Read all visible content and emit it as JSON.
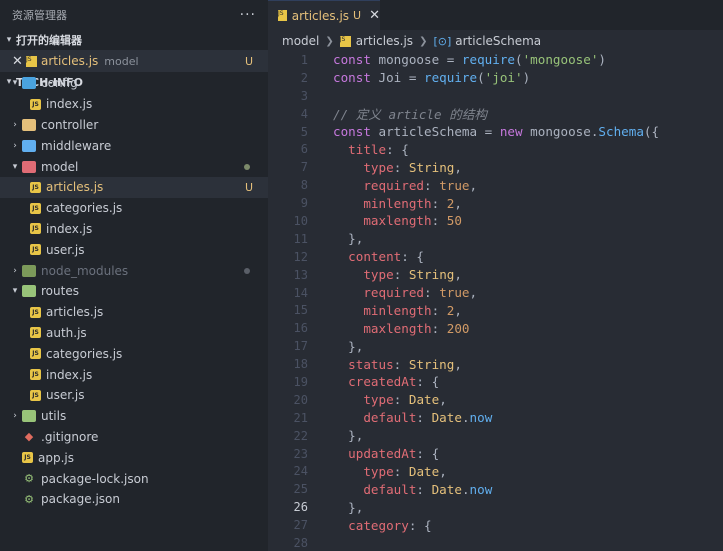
{
  "sidebar": {
    "title": "资源管理器",
    "more": "···",
    "open_editors_title": "打开的编辑器",
    "open_editor": {
      "close": "✕",
      "name": "articles.js",
      "dir": "model",
      "status": "U"
    },
    "project_title": "TECH-INFO",
    "tree": [
      {
        "label": "config",
        "kind": "folder",
        "expanded": true,
        "depth": 0,
        "folder_color": "#4aa3df"
      },
      {
        "label": "index.js",
        "kind": "js",
        "depth": 1
      },
      {
        "label": "controller",
        "kind": "folder",
        "expanded": false,
        "depth": 0,
        "folder_color": "#e5c07b"
      },
      {
        "label": "middleware",
        "kind": "folder",
        "expanded": false,
        "depth": 0,
        "folder_color": "#61afef"
      },
      {
        "label": "model",
        "kind": "folder",
        "expanded": true,
        "depth": 0,
        "folder_color": "#e06c75",
        "dot": true
      },
      {
        "label": "articles.js",
        "kind": "js",
        "depth": 1,
        "selected": true,
        "status": "U"
      },
      {
        "label": "categories.js",
        "kind": "js",
        "depth": 1
      },
      {
        "label": "index.js",
        "kind": "js",
        "depth": 1
      },
      {
        "label": "user.js",
        "kind": "js",
        "depth": 1
      },
      {
        "label": "node_modules",
        "kind": "folder",
        "expanded": false,
        "depth": 0,
        "folder_color": "#7c9a5a",
        "dim": true,
        "dot_grey": true
      },
      {
        "label": "routes",
        "kind": "folder",
        "expanded": true,
        "depth": 0,
        "folder_color": "#98c379"
      },
      {
        "label": "articles.js",
        "kind": "js",
        "depth": 1
      },
      {
        "label": "auth.js",
        "kind": "js",
        "depth": 1
      },
      {
        "label": "categories.js",
        "kind": "js",
        "depth": 1
      },
      {
        "label": "index.js",
        "kind": "js",
        "depth": 1
      },
      {
        "label": "user.js",
        "kind": "js",
        "depth": 1
      },
      {
        "label": "utils",
        "kind": "folder",
        "expanded": false,
        "depth": 0,
        "folder_color": "#98c379"
      },
      {
        "label": ".gitignore",
        "kind": "git",
        "depth": 0
      },
      {
        "label": "app.js",
        "kind": "js",
        "depth": 0
      },
      {
        "label": "package-lock.json",
        "kind": "json",
        "depth": 0
      },
      {
        "label": "package.json",
        "kind": "json",
        "depth": 0
      }
    ]
  },
  "editor": {
    "tab": {
      "name": "articles.js",
      "status": "U",
      "close": "✕"
    },
    "breadcrumb": {
      "folder": "model",
      "file": "articles.js",
      "symbol": "articleSchema"
    },
    "active_line": 26,
    "lines": [
      [
        [
          "kw",
          "const "
        ],
        [
          "plain",
          "mongoose = "
        ],
        [
          "fn",
          "require"
        ],
        [
          "pun",
          "("
        ],
        [
          "str",
          "'mongoose'"
        ],
        [
          "pun",
          ")"
        ]
      ],
      [
        [
          "kw",
          "const "
        ],
        [
          "plain",
          "Joi = "
        ],
        [
          "fn",
          "require"
        ],
        [
          "pun",
          "("
        ],
        [
          "str",
          "'joi'"
        ],
        [
          "pun",
          ")"
        ]
      ],
      [],
      [
        [
          "cm",
          "// 定义 article 的结构"
        ]
      ],
      [
        [
          "kw",
          "const "
        ],
        [
          "plain",
          "articleSchema = "
        ],
        [
          "kw",
          "new "
        ],
        [
          "plain",
          "mongoose."
        ],
        [
          "fn",
          "Schema"
        ],
        [
          "pun",
          "({"
        ]
      ],
      [
        [
          "plain",
          "  "
        ],
        [
          "prop",
          "title"
        ],
        [
          "pun",
          ": {"
        ]
      ],
      [
        [
          "plain",
          "    "
        ],
        [
          "prop",
          "type"
        ],
        [
          "pun",
          ": "
        ],
        [
          "type",
          "String"
        ],
        [
          "pun",
          ","
        ]
      ],
      [
        [
          "plain",
          "    "
        ],
        [
          "prop",
          "required"
        ],
        [
          "pun",
          ": "
        ],
        [
          "bool",
          "true"
        ],
        [
          "pun",
          ","
        ]
      ],
      [
        [
          "plain",
          "    "
        ],
        [
          "prop",
          "minlength"
        ],
        [
          "pun",
          ": "
        ],
        [
          "num",
          "2"
        ],
        [
          "pun",
          ","
        ]
      ],
      [
        [
          "plain",
          "    "
        ],
        [
          "prop",
          "maxlength"
        ],
        [
          "pun",
          ": "
        ],
        [
          "num",
          "50"
        ]
      ],
      [
        [
          "plain",
          "  "
        ],
        [
          "pun",
          "},"
        ]
      ],
      [
        [
          "plain",
          "  "
        ],
        [
          "prop",
          "content"
        ],
        [
          "pun",
          ": {"
        ]
      ],
      [
        [
          "plain",
          "    "
        ],
        [
          "prop",
          "type"
        ],
        [
          "pun",
          ": "
        ],
        [
          "type",
          "String"
        ],
        [
          "pun",
          ","
        ]
      ],
      [
        [
          "plain",
          "    "
        ],
        [
          "prop",
          "required"
        ],
        [
          "pun",
          ": "
        ],
        [
          "bool",
          "true"
        ],
        [
          "pun",
          ","
        ]
      ],
      [
        [
          "plain",
          "    "
        ],
        [
          "prop",
          "minlength"
        ],
        [
          "pun",
          ": "
        ],
        [
          "num",
          "2"
        ],
        [
          "pun",
          ","
        ]
      ],
      [
        [
          "plain",
          "    "
        ],
        [
          "prop",
          "maxlength"
        ],
        [
          "pun",
          ": "
        ],
        [
          "num",
          "200"
        ]
      ],
      [
        [
          "plain",
          "  "
        ],
        [
          "pun",
          "},"
        ]
      ],
      [
        [
          "plain",
          "  "
        ],
        [
          "prop",
          "status"
        ],
        [
          "pun",
          ": "
        ],
        [
          "type",
          "String"
        ],
        [
          "pun",
          ","
        ]
      ],
      [
        [
          "plain",
          "  "
        ],
        [
          "prop",
          "createdAt"
        ],
        [
          "pun",
          ": {"
        ]
      ],
      [
        [
          "plain",
          "    "
        ],
        [
          "prop",
          "type"
        ],
        [
          "pun",
          ": "
        ],
        [
          "type",
          "Date"
        ],
        [
          "pun",
          ","
        ]
      ],
      [
        [
          "plain",
          "    "
        ],
        [
          "prop",
          "default"
        ],
        [
          "pun",
          ": "
        ],
        [
          "type",
          "Date"
        ],
        [
          "pun",
          "."
        ],
        [
          "fn",
          "now"
        ]
      ],
      [
        [
          "plain",
          "  "
        ],
        [
          "pun",
          "},"
        ]
      ],
      [
        [
          "plain",
          "  "
        ],
        [
          "prop",
          "updatedAt"
        ],
        [
          "pun",
          ": {"
        ]
      ],
      [
        [
          "plain",
          "    "
        ],
        [
          "prop",
          "type"
        ],
        [
          "pun",
          ": "
        ],
        [
          "type",
          "Date"
        ],
        [
          "pun",
          ","
        ]
      ],
      [
        [
          "plain",
          "    "
        ],
        [
          "prop",
          "default"
        ],
        [
          "pun",
          ": "
        ],
        [
          "type",
          "Date"
        ],
        [
          "pun",
          "."
        ],
        [
          "fn",
          "now"
        ]
      ],
      [
        [
          "plain",
          "  "
        ],
        [
          "pun",
          "},"
        ]
      ],
      [
        [
          "plain",
          "  "
        ],
        [
          "prop",
          "category"
        ],
        [
          "pun",
          ": {"
        ]
      ],
      []
    ]
  }
}
